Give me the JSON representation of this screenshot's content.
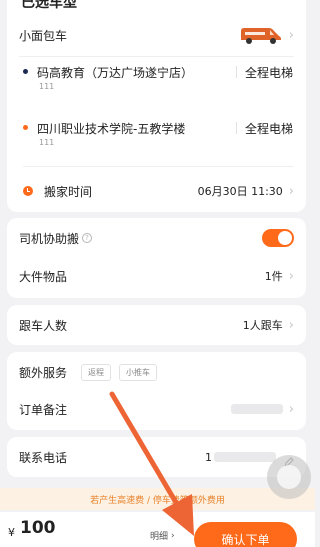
{
  "header": {
    "title": "已选车型"
  },
  "vehicle": {
    "label": "小面包车"
  },
  "route": {
    "origin": {
      "name": "码高教育（万达广场遂宁店）",
      "sub": "111",
      "elevator": "全程电梯"
    },
    "destination": {
      "name": "四川职业技术学院-五教学楼",
      "sub": "111",
      "elevator": "全程电梯"
    }
  },
  "move_time": {
    "label": "搬家时间",
    "value": "06月30日 11:30"
  },
  "options": {
    "driver_help": {
      "label": "司机协助搬",
      "enabled": true
    },
    "large_items": {
      "label": "大件物品",
      "value": "1件"
    }
  },
  "passengers": {
    "label": "跟车人数",
    "value": "1人跟车"
  },
  "extra": {
    "label": "额外服务",
    "tags": [
      "返程",
      "小推车"
    ],
    "remark_label": "订单备注"
  },
  "contact": {
    "label": "联系电话",
    "value_prefix": "1"
  },
  "notice": {
    "text": "若产生高速费 / 停车费等额外费用"
  },
  "footer": {
    "currency": "¥",
    "price": "100",
    "detail_label": "明细",
    "confirm_label": "确认下单"
  },
  "colors": {
    "accent": "#ff6a1a",
    "origin_dot": "#1c2a52",
    "dest_dot": "#ff6a1a",
    "notice_bg": "#fdf1e3"
  }
}
